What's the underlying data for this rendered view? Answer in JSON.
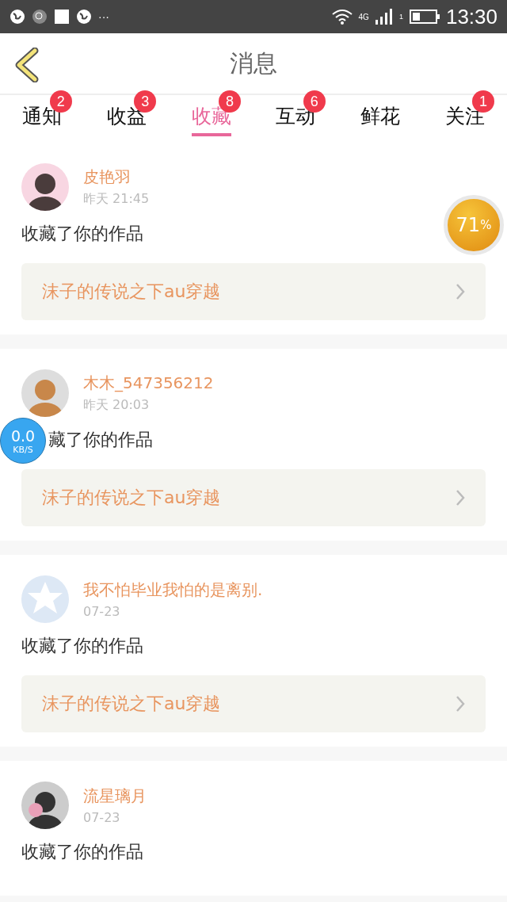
{
  "status_bar": {
    "time": "13:30",
    "network": "4G",
    "sim": "1",
    "more": "···"
  },
  "header": {
    "title": "消息"
  },
  "tabs": [
    {
      "label": "通知",
      "badge": "2",
      "selected": false
    },
    {
      "label": "收益",
      "badge": "3",
      "selected": false
    },
    {
      "label": "收藏",
      "badge": "8",
      "selected": true
    },
    {
      "label": "互动",
      "badge": "6",
      "selected": false
    },
    {
      "label": "鲜花",
      "selected": false
    },
    {
      "label": "关注",
      "badge": "1",
      "selected": false
    }
  ],
  "messages": [
    {
      "name": "皮艳羽",
      "time": "昨天 21:45",
      "text": "收藏了你的作品",
      "kind": "full",
      "work": "沫子的传说之下au穿越"
    },
    {
      "name": "木木_547356212",
      "time": "昨天 20:03",
      "text": "藏了你的作品",
      "kind": "partial",
      "work": "沫子的传说之下au穿越"
    },
    {
      "name": "我不怕毕业我怕的是离别.",
      "time": "07-23",
      "text": "收藏了你的作品",
      "kind": "full",
      "work": "沫子的传说之下au穿越"
    },
    {
      "name": "流星璃月",
      "time": "07-23",
      "text": "收藏了你的作品",
      "kind": "full"
    }
  ],
  "memory_widget": {
    "value": "71",
    "unit": "%"
  },
  "speed_widget": {
    "value": "0.0",
    "unit": "KB/S"
  }
}
